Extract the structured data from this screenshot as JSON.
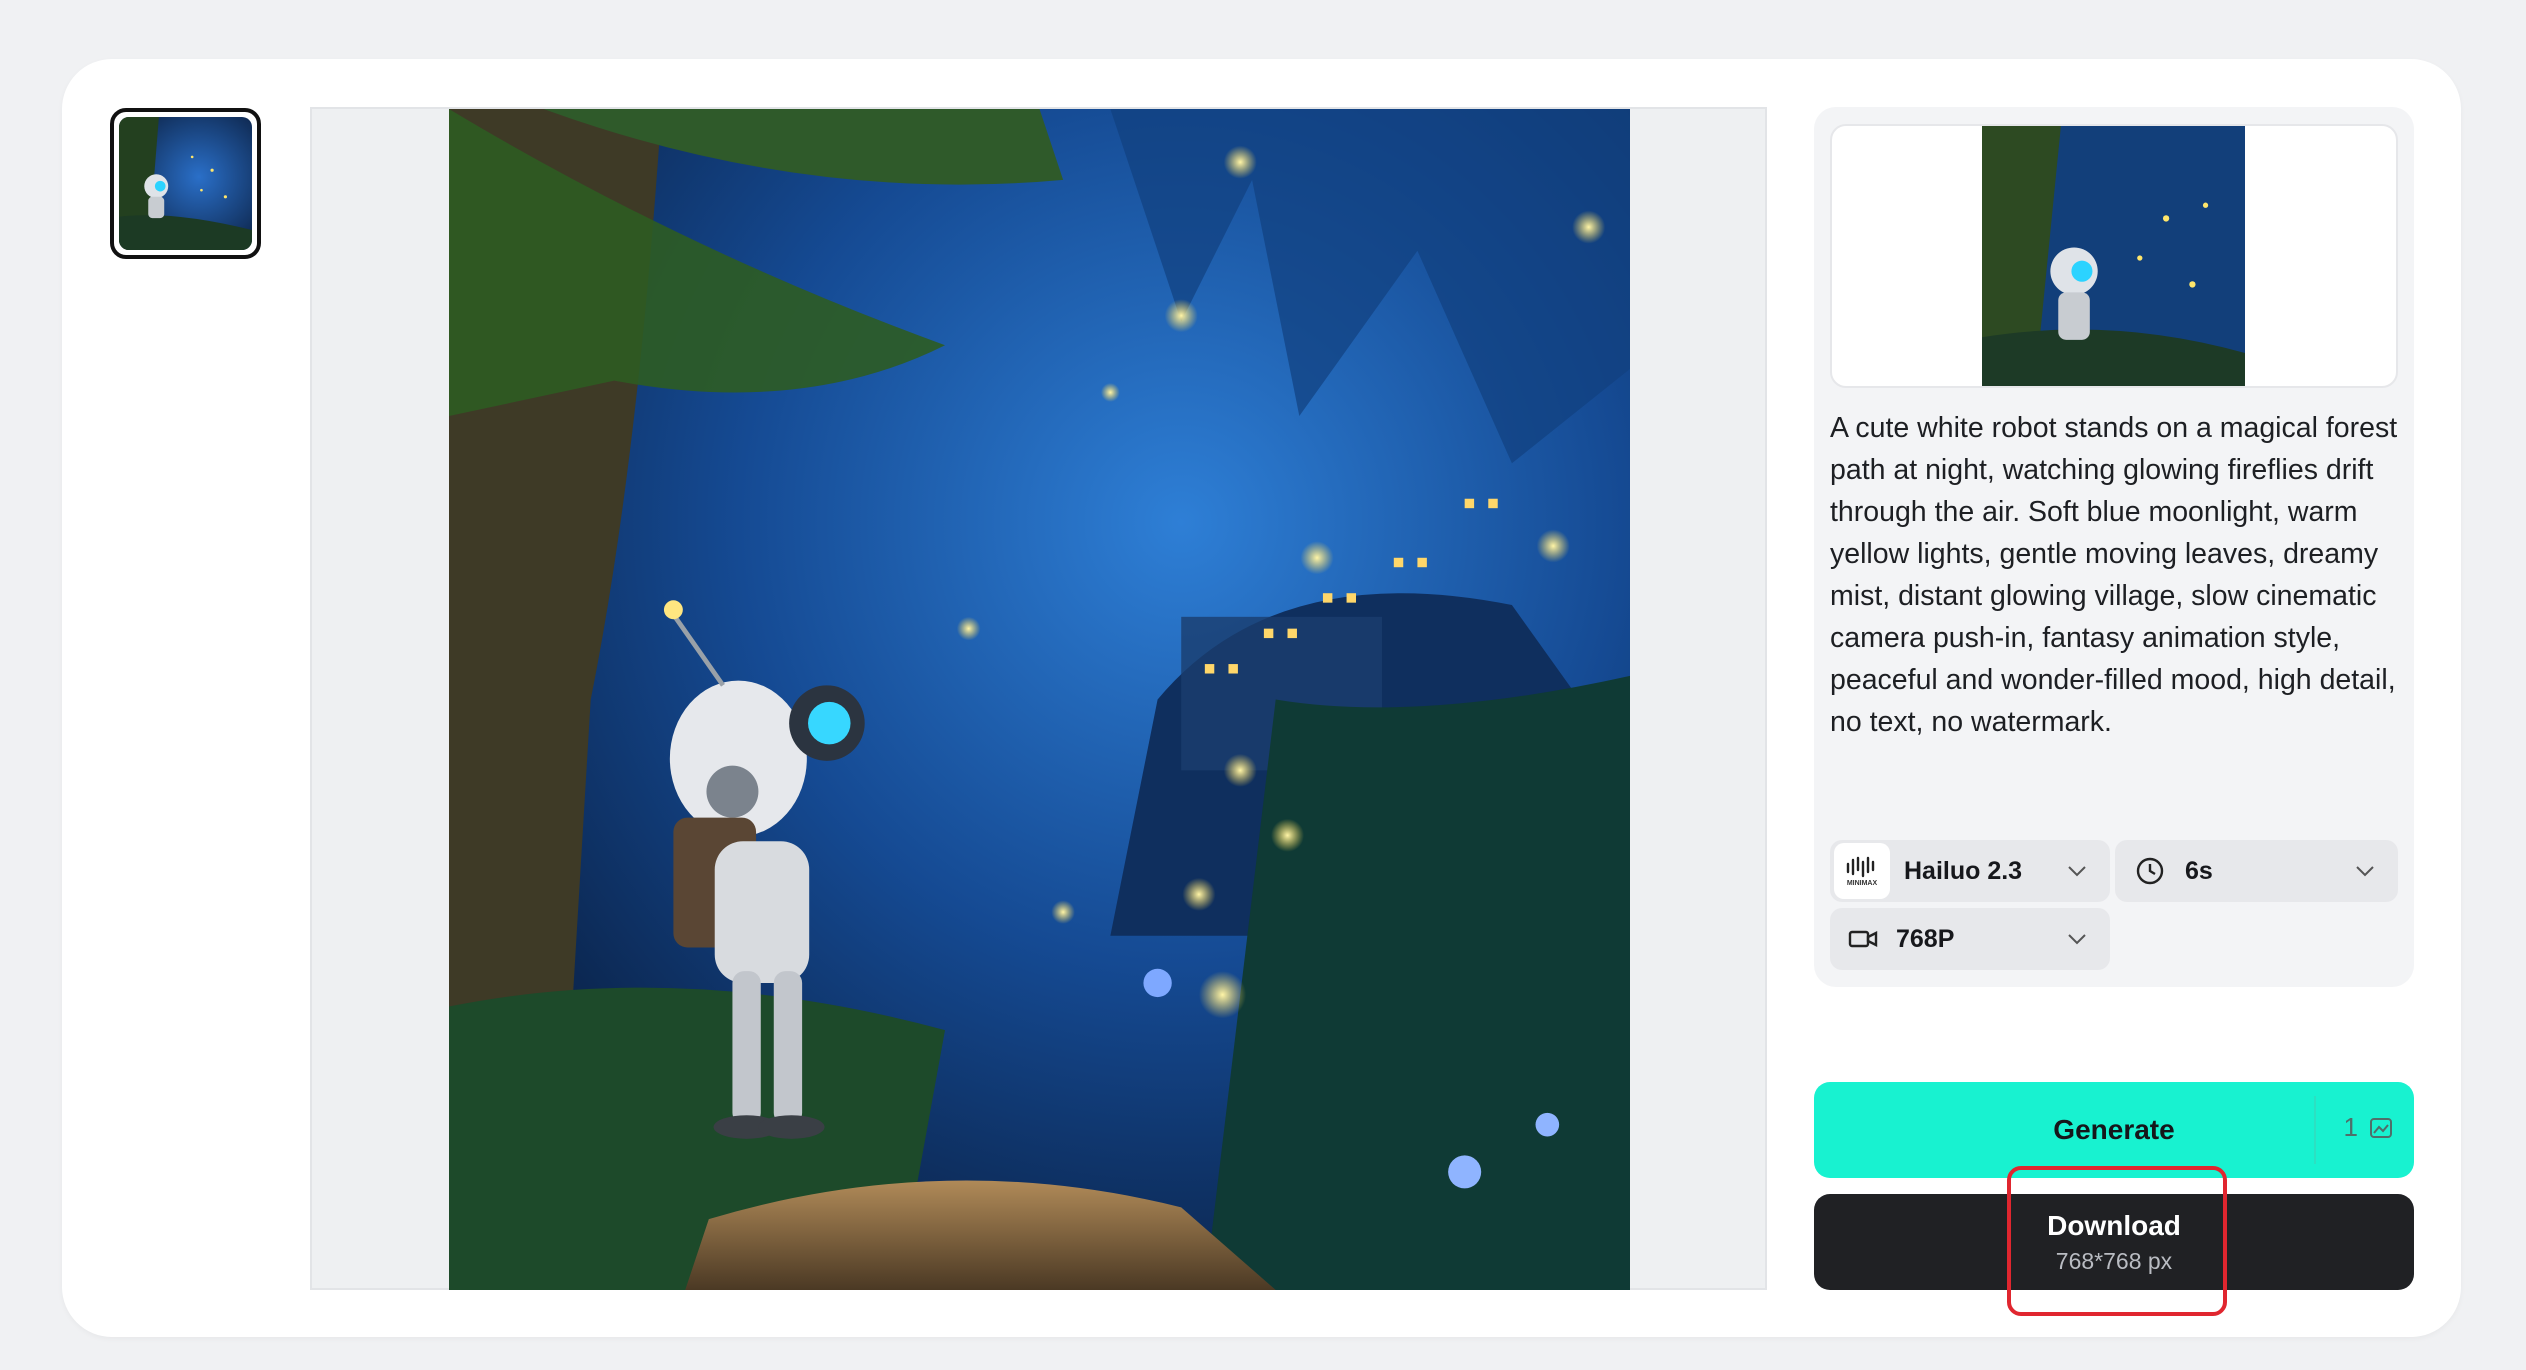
{
  "thumbnail": {
    "alt": "robot forest thumbnail"
  },
  "prompt_text": "A cute white robot stands on a magical forest path at night, watching glowing fireflies drift through the air. Soft blue moonlight, warm yellow lights, gentle moving leaves, dreamy mist, distant glowing village, slow cinematic camera push-in, fantasy animation style, peaceful and wonder-filled mood, high detail, no text, no watermark.",
  "settings": {
    "model": {
      "label": "Hailuo 2.3",
      "logo_text": "MINIMAX",
      "icon": "minimax-logo-icon"
    },
    "duration": {
      "label": "6s",
      "icon": "clock-icon"
    },
    "resolution": {
      "label": "768P",
      "icon": "video-camera-icon"
    }
  },
  "generate": {
    "label": "Generate",
    "credits": "1",
    "icon": "image-credit-icon"
  },
  "download": {
    "label": "Download",
    "size": "768*768 px"
  },
  "colors": {
    "accent": "#18f2d0",
    "download_bg": "#202124",
    "highlight": "#e0262f"
  }
}
